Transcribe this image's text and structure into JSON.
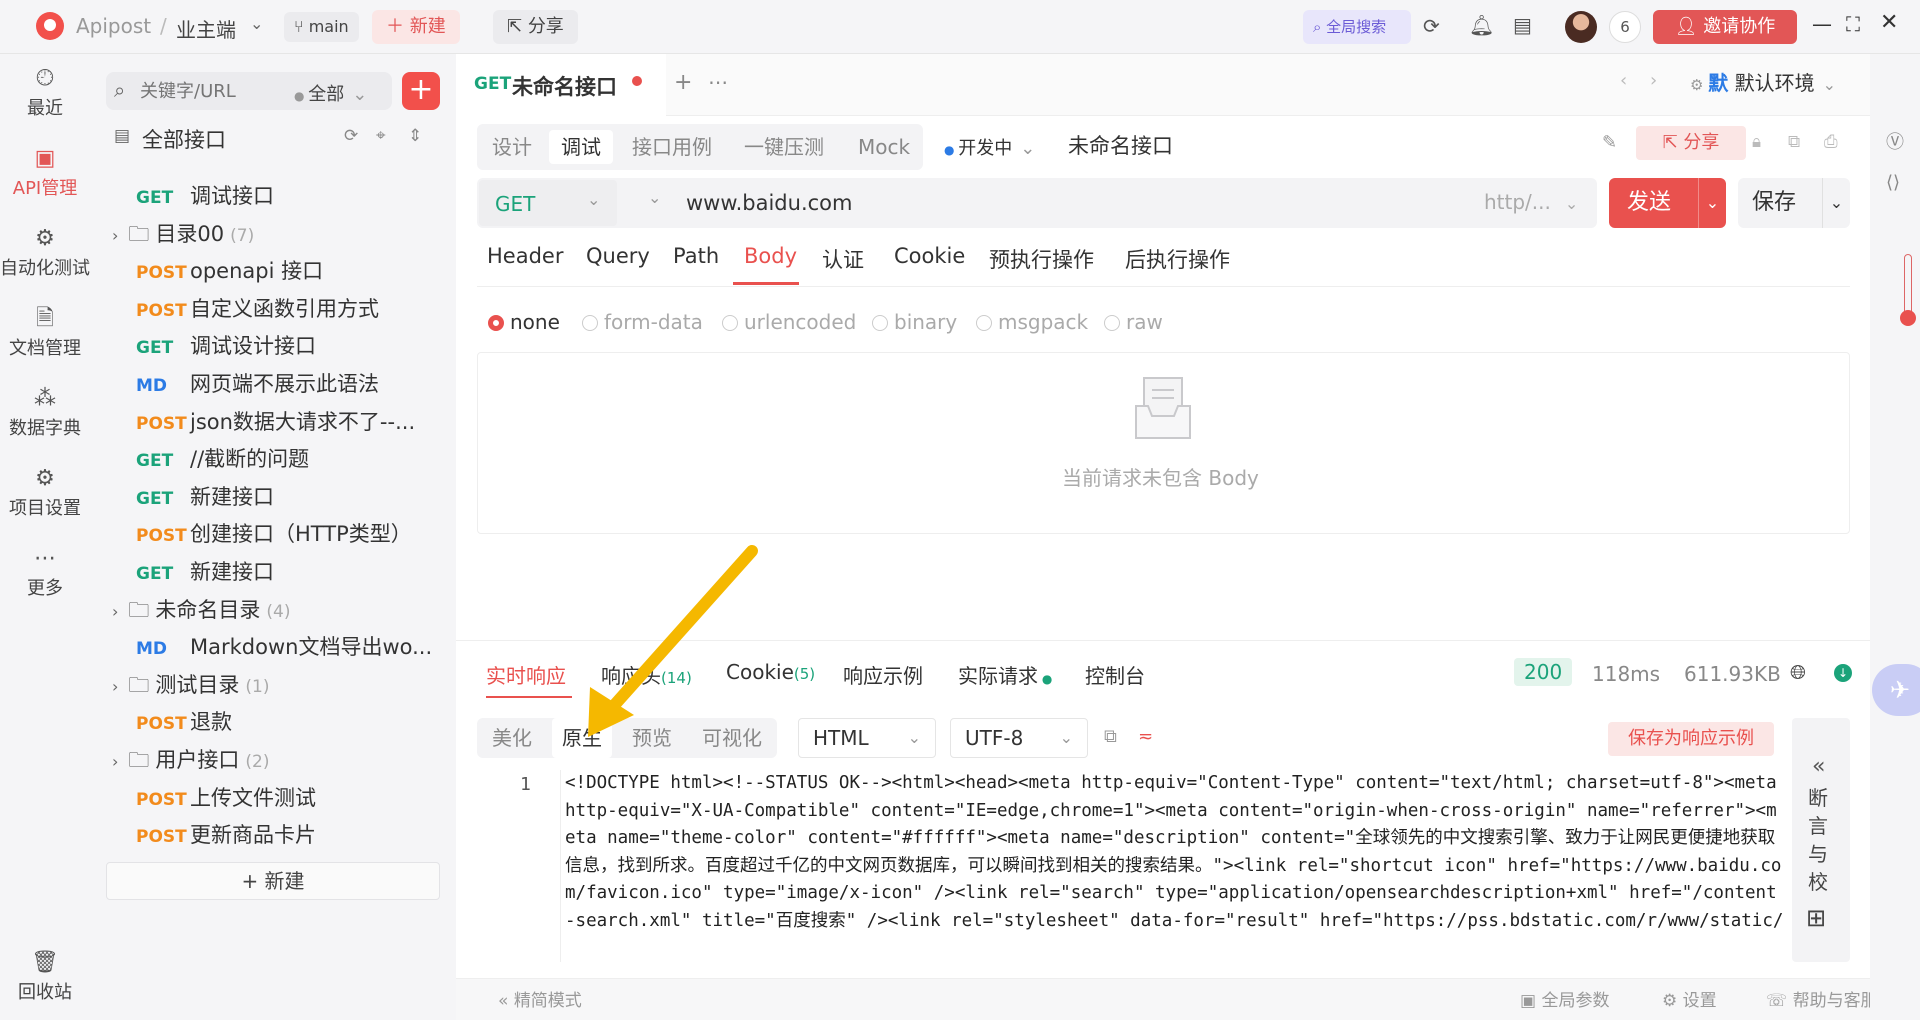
{
  "topbar": {
    "app": "Apipost",
    "sep": "/",
    "project": "业主端",
    "branch": "main",
    "new_label": "新建",
    "share_label": "分享",
    "global_search": "全局搜索",
    "member_count": "6",
    "invite": "邀请协作"
  },
  "rail": [
    {
      "label": "最近",
      "icon": "history-icon"
    },
    {
      "label": "API管理",
      "icon": "api-icon"
    },
    {
      "label": "自动化测试",
      "icon": "automation-icon"
    },
    {
      "label": "文档管理",
      "icon": "doc-icon"
    },
    {
      "label": "数据字典",
      "icon": "dict-icon"
    },
    {
      "label": "项目设置",
      "icon": "settings-icon"
    },
    {
      "label": "更多",
      "icon": "more-icon"
    },
    {
      "label": "回收站",
      "icon": "trash-icon"
    }
  ],
  "tree": {
    "search_placeholder": "关键字/URL",
    "filter": "全部",
    "root": "全部接口",
    "items": [
      {
        "method": "GET",
        "name": "调试接口"
      },
      {
        "folder": true,
        "name": "目录00",
        "count": "(7)"
      },
      {
        "method": "POST",
        "name": "openapi 接口"
      },
      {
        "method": "POST",
        "name": "自定义函数引用方式"
      },
      {
        "method": "GET",
        "name": "调试设计接口"
      },
      {
        "method": "MD",
        "name": "网页端不展示此语法"
      },
      {
        "method": "POST",
        "name": "json数据大请求不了--..."
      },
      {
        "method": "GET",
        "name": "//截断的问题"
      },
      {
        "method": "GET",
        "name": "新建接口"
      },
      {
        "method": "POST",
        "name": "创建接口（HTTP类型）"
      },
      {
        "method": "GET",
        "name": "新建接口"
      },
      {
        "folder": true,
        "name": "未命名目录",
        "count": "(4)"
      },
      {
        "method": "MD",
        "name": "Markdown文档导出wo..."
      },
      {
        "folder": true,
        "name": "测试目录",
        "count": "(1)"
      },
      {
        "method": "POST",
        "name": "退款"
      },
      {
        "folder": true,
        "name": "用户接口",
        "count": "(2)"
      },
      {
        "method": "POST",
        "name": "上传文件测试"
      },
      {
        "method": "POST",
        "name": "更新商品卡片"
      }
    ],
    "new_label": "+ 新建"
  },
  "tab": {
    "method": "GET",
    "title": "未命名接口"
  },
  "env": {
    "short": "默",
    "name": "默认环境"
  },
  "subtabs": [
    "设计",
    "调试",
    "接口用例",
    "一键压测",
    "Mock"
  ],
  "status_label": "开发中",
  "api_name": "未命名接口",
  "share_btn": "分享",
  "request": {
    "method": "GET",
    "url": "www.baidu.com",
    "protocol": "http/...",
    "send": "发送",
    "save": "保存"
  },
  "req_tabs": [
    "Header",
    "Query",
    "Path",
    "Body",
    "认证",
    "Cookie",
    "预执行操作",
    "后执行操作"
  ],
  "body_types": [
    "none",
    "form-data",
    "urlencoded",
    "binary",
    "msgpack",
    "raw"
  ],
  "body_empty": "当前请求未包含 Body",
  "response": {
    "tabs": [
      "实时响应",
      "响应头",
      "Cookie",
      "响应示例",
      "实际请求",
      "控制台"
    ],
    "header_count": "(14)",
    "cookie_count": "(5)",
    "status": "200",
    "time": "118ms",
    "size": "611.93KB",
    "formats": [
      "美化",
      "原生",
      "预览",
      "可视化"
    ],
    "lang": "HTML",
    "charset": "UTF-8",
    "save_example": "保存为响应示例",
    "line_no": "1",
    "code": "<!DOCTYPE html><!--STATUS OK--><html><head><meta http-equiv=\"Content-Type\" content=\"text/html; charset=utf-8\"><meta http-equiv=\"X-UA-Compatible\" content=\"IE=edge,chrome=1\"><meta content=\"origin-when-cross-origin\" name=\"referrer\"><meta name=\"theme-color\" content=\"#ffffff\"><meta name=\"description\" content=\"全球领先的中文搜索引擎、致力于让网民更便捷地获取信息，找到所求。百度超过千亿的中文网页数据库，可以瞬间找到相关的搜索结果。\"><link rel=\"shortcut icon\" href=\"https://www.baidu.com/favicon.ico\" type=\"image/x-icon\" /><link rel=\"search\" type=\"application/opensearchdescription+xml\" href=\"/content-search.xml\" title=\"百度搜索\" /><link rel=\"stylesheet\" data-for=\"result\" href=\"https://pss.bdstatic.com/r/www/static/",
    "assert_label": "断言与校验"
  },
  "footer": {
    "mode": "精简模式",
    "params": "全局参数",
    "settings": "设置",
    "help": "帮助与客服"
  },
  "colors": {
    "brand": "#e9514e",
    "get": "#1ba37a",
    "post": "#f28b1c",
    "md": "#2c7be5",
    "arrow": "#f5b800"
  }
}
